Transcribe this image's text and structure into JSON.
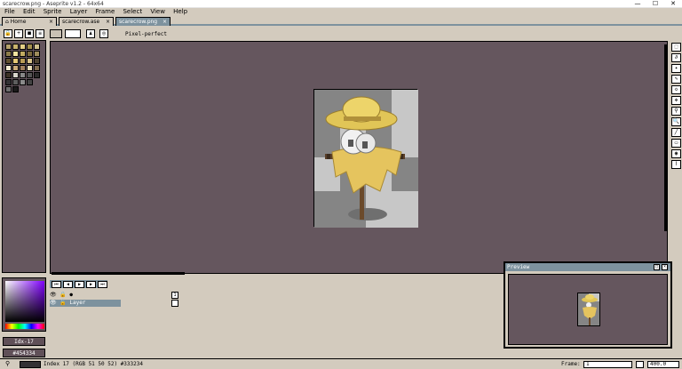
{
  "window": {
    "title": "scarecrow.png - Aseprite v1.2 - 64x64",
    "minimize": "—",
    "maximize": "☐",
    "close": "✕"
  },
  "menu": [
    "File",
    "Edit",
    "Sprite",
    "Layer",
    "Frame",
    "Select",
    "View",
    "Help"
  ],
  "tabs": [
    {
      "label": "Home",
      "close": "×"
    },
    {
      "label": "scarecrow.ase",
      "close": "×"
    },
    {
      "label": "scarecrow.png",
      "close": "×"
    }
  ],
  "toolbar": {
    "pixel_perfect": "Pixel-perfect"
  },
  "timeline": {
    "layer_name": "Layer",
    "frame_number": "1"
  },
  "preview": {
    "title": "Preview"
  },
  "colors": {
    "index_label": "Idx-17",
    "hex_label": "#454334"
  },
  "status": {
    "text": "Index 17 (RGB 51 50 52) #333234",
    "frame_label": "Frame:",
    "frame_value": "1",
    "zoom_value": "400.0"
  },
  "accent": "#7d929e",
  "canvas_bg": "#65565e"
}
